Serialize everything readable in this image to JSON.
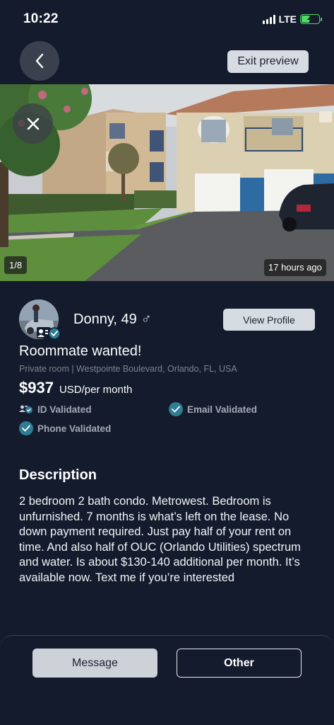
{
  "status_bar": {
    "time": "10:22",
    "network": "LTE"
  },
  "nav": {
    "exit_label": "Exit preview"
  },
  "photo": {
    "counter": "1/8",
    "posted": "17 hours ago"
  },
  "profile": {
    "name": "Donny, 49",
    "gender_symbol": "♂",
    "view_label": "View Profile"
  },
  "listing": {
    "title": "Roommate wanted!",
    "location": "Private room | Westpointe Boulevard, Orlando, FL, USA",
    "price": "$937",
    "price_unit": "USD/per month"
  },
  "verifications": {
    "id": "ID Validated",
    "email": "Email Validated",
    "phone": "Phone Validated"
  },
  "description": {
    "heading": "Description",
    "body": "2 bedroom 2 bath condo. Metrowest. Bedroom is unfurnished. 7 months is what’s left on the lease. No down payment required. Just pay half of your rent on time. And also half of OUC (Orlando Utilities) spectrum and water. Is about $130-140 additional per month. It’s available now. Text me if you’re interested"
  },
  "actions": {
    "message_label": "Message",
    "other_label": "Other"
  },
  "colors": {
    "background": "#141b2d",
    "accent": "#2e7d95",
    "button_light": "#d7dbe2"
  }
}
